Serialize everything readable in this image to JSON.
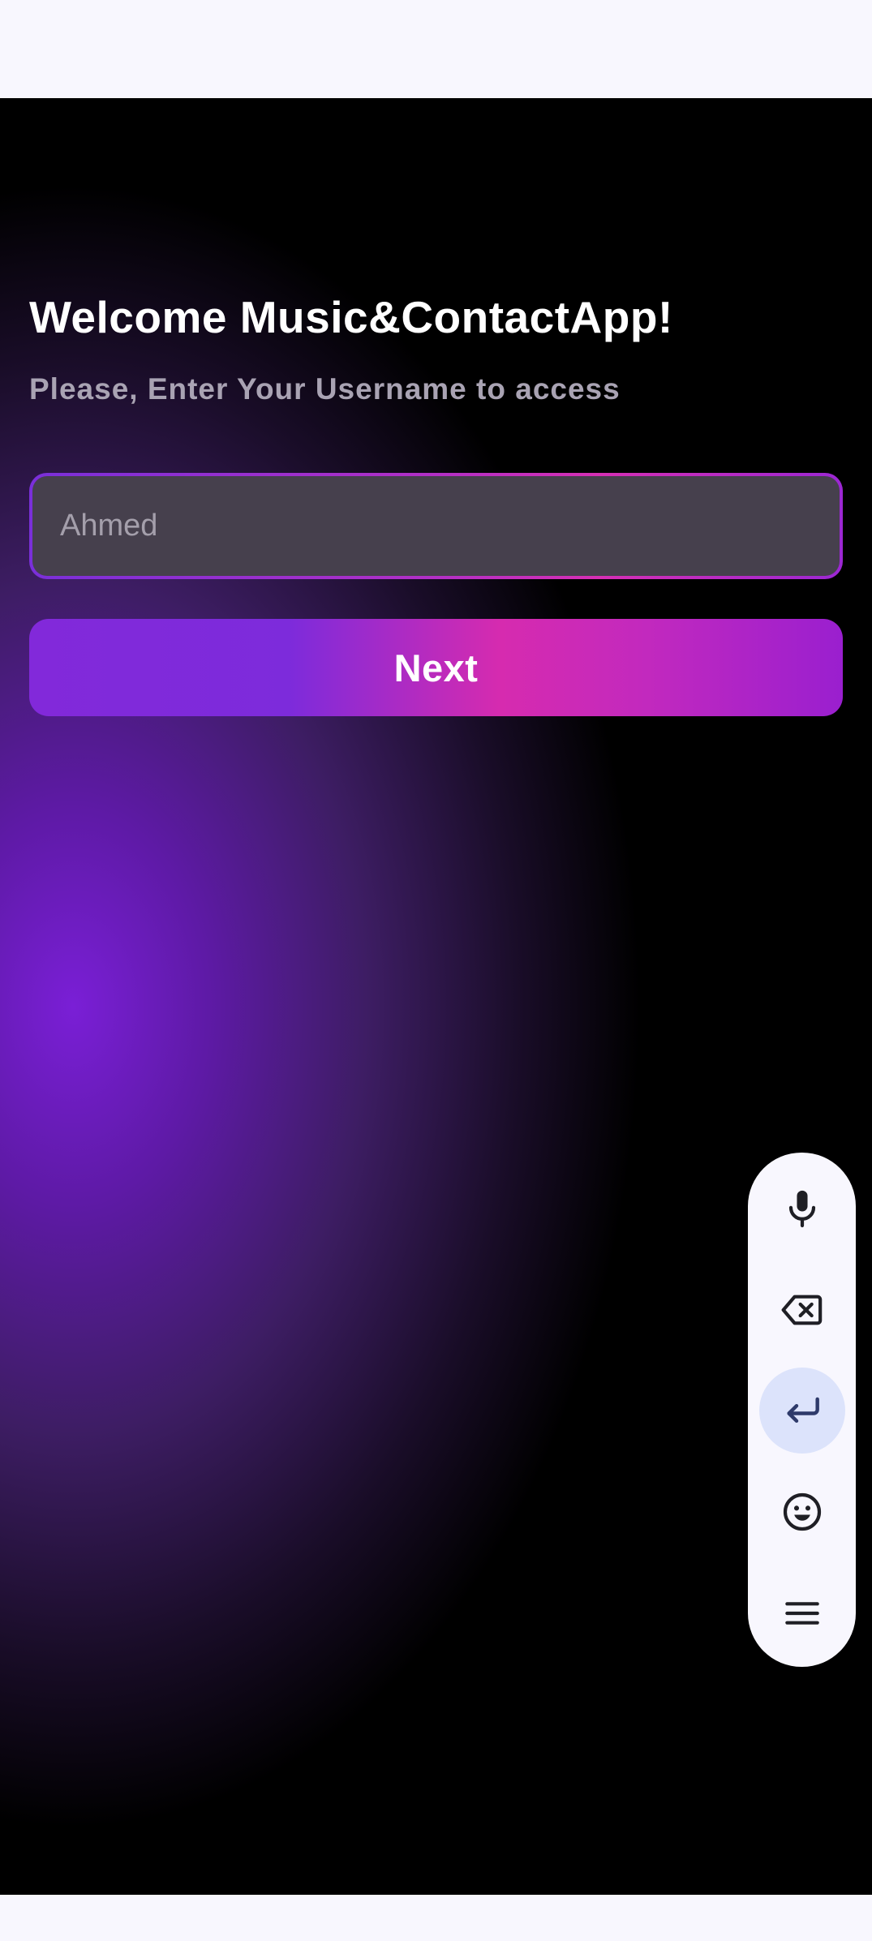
{
  "welcome": {
    "title": "Welcome Music&ContactApp!",
    "subtitle": "Please, Enter Your Username to access"
  },
  "username_input": {
    "placeholder": "Ahmed",
    "value": ""
  },
  "next_button": {
    "label": "Next"
  },
  "keyboard_toolbar": {
    "items": [
      {
        "icon": "microphone-icon"
      },
      {
        "icon": "backspace-icon"
      },
      {
        "icon": "enter-icon",
        "active": true
      },
      {
        "icon": "emoji-icon"
      },
      {
        "icon": "menu-icon"
      }
    ]
  },
  "colors": {
    "background_dark": "#000000",
    "background_glow": "#7a1fd6",
    "accent_purple": "#8229da",
    "accent_pink": "#d62baf",
    "input_fill": "#46404d",
    "toolbar_bg": "#f8f7fe",
    "toolbar_active": "#dce3fb"
  }
}
